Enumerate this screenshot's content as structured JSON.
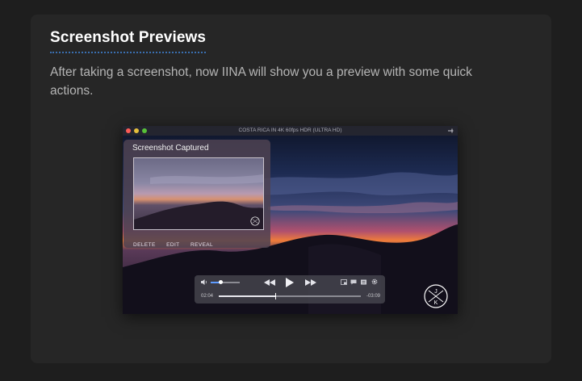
{
  "section": {
    "title": "Screenshot Previews",
    "description": "After taking a screenshot, now IINA will show you a preview with some quick actions."
  },
  "player": {
    "window_title": "COSTA RICA IN 4K 60fps HDR (ULTRA HD)",
    "preview": {
      "title": "Screenshot Captured",
      "actions": {
        "delete": "DELETE",
        "edit": "EDIT",
        "reveal": "REVEAL"
      }
    },
    "controls": {
      "elapsed": "02:04",
      "remaining": "-03:09",
      "progress": 0.4,
      "volume": 0.35
    },
    "logo_letters": [
      "J",
      "K"
    ],
    "icons": [
      "pin-icon",
      "volume-icon",
      "rewind-icon",
      "play-icon",
      "fast-forward-icon",
      "pip-icon",
      "subtitle-icon",
      "playlist-icon",
      "settings-icon"
    ]
  },
  "colors": {
    "accent": "#3a6fb0",
    "volume": "#5e9bff"
  }
}
